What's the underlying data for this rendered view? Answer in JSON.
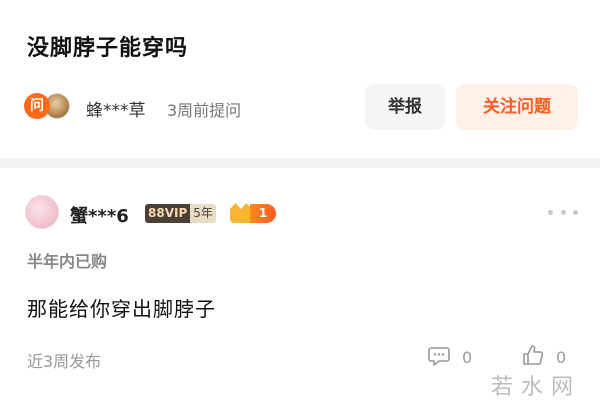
{
  "question": {
    "title": "没脚脖子能穿吗",
    "ask_badge": "问",
    "asker_name": "蜂***草",
    "ask_time": "3周前提问",
    "report_label": "举报",
    "follow_label": "关注问题"
  },
  "answer": {
    "user_name": "蟹***6",
    "vip_label": "88VIP",
    "vip_years": "5年",
    "fan_level": "1",
    "purchase_tag": "半年内已购",
    "text": "那能给你穿出脚脖子",
    "time": "近3周发布",
    "comment_count": "0",
    "like_count": "0"
  },
  "watermark": "若水网",
  "colors": {
    "accent": "#ff5a1f",
    "follow_bg": "#fff0e8",
    "report_bg": "#f4f5f7",
    "divider": "#f3f3f5"
  },
  "icons": [
    "ask-badge",
    "more-icon",
    "comment-icon",
    "like-icon"
  ]
}
